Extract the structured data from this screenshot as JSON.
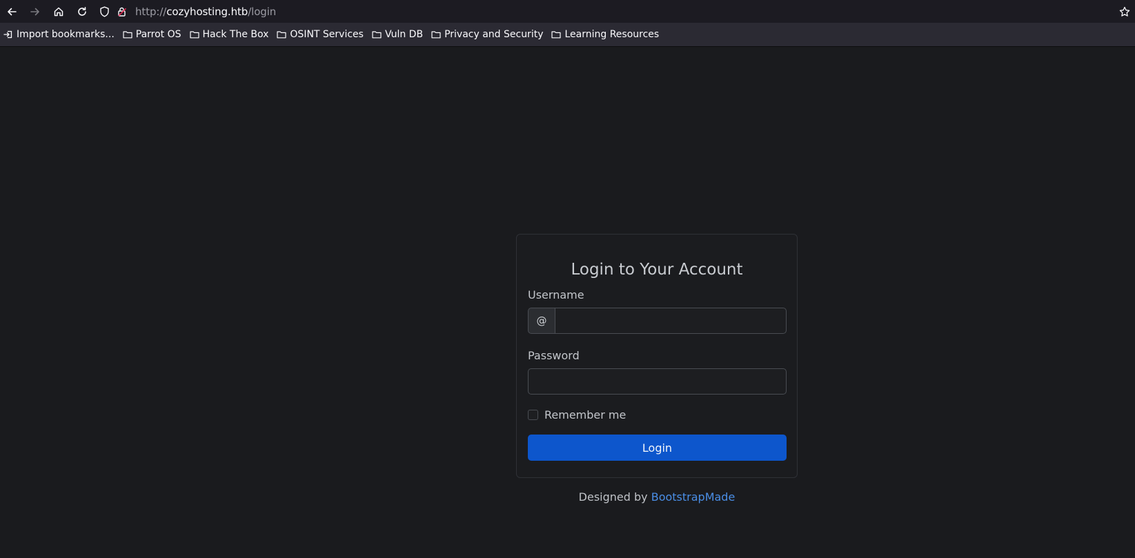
{
  "browser": {
    "url": {
      "scheme": "http://",
      "host": "cozyhosting.htb",
      "path": "/login"
    },
    "nav_icons": [
      "back-arrow-icon",
      "forward-arrow-icon",
      "home-icon",
      "reload-icon"
    ],
    "bookmarks": [
      {
        "label": "Import bookmarks...",
        "icon": "import-icon"
      },
      {
        "label": "Parrot OS",
        "icon": "folder-icon"
      },
      {
        "label": "Hack The Box",
        "icon": "folder-icon"
      },
      {
        "label": "OSINT Services",
        "icon": "folder-icon"
      },
      {
        "label": "Vuln DB",
        "icon": "folder-icon"
      },
      {
        "label": "Privacy and Security",
        "icon": "folder-icon"
      },
      {
        "label": "Learning Resources",
        "icon": "folder-icon"
      }
    ]
  },
  "login": {
    "title": "Login to Your Account",
    "username_label": "Username",
    "username_prefix": "@",
    "username_value": "",
    "password_label": "Password",
    "password_value": "",
    "remember_label": "Remember me",
    "remember_checked": false,
    "button_label": "Login"
  },
  "footer": {
    "designed_by": "Designed by",
    "link_text": "BootstrapMade"
  },
  "colors": {
    "page_background": "#1a1b1e",
    "primary_button": "#0d56cc",
    "link": "#4a8ee6"
  }
}
